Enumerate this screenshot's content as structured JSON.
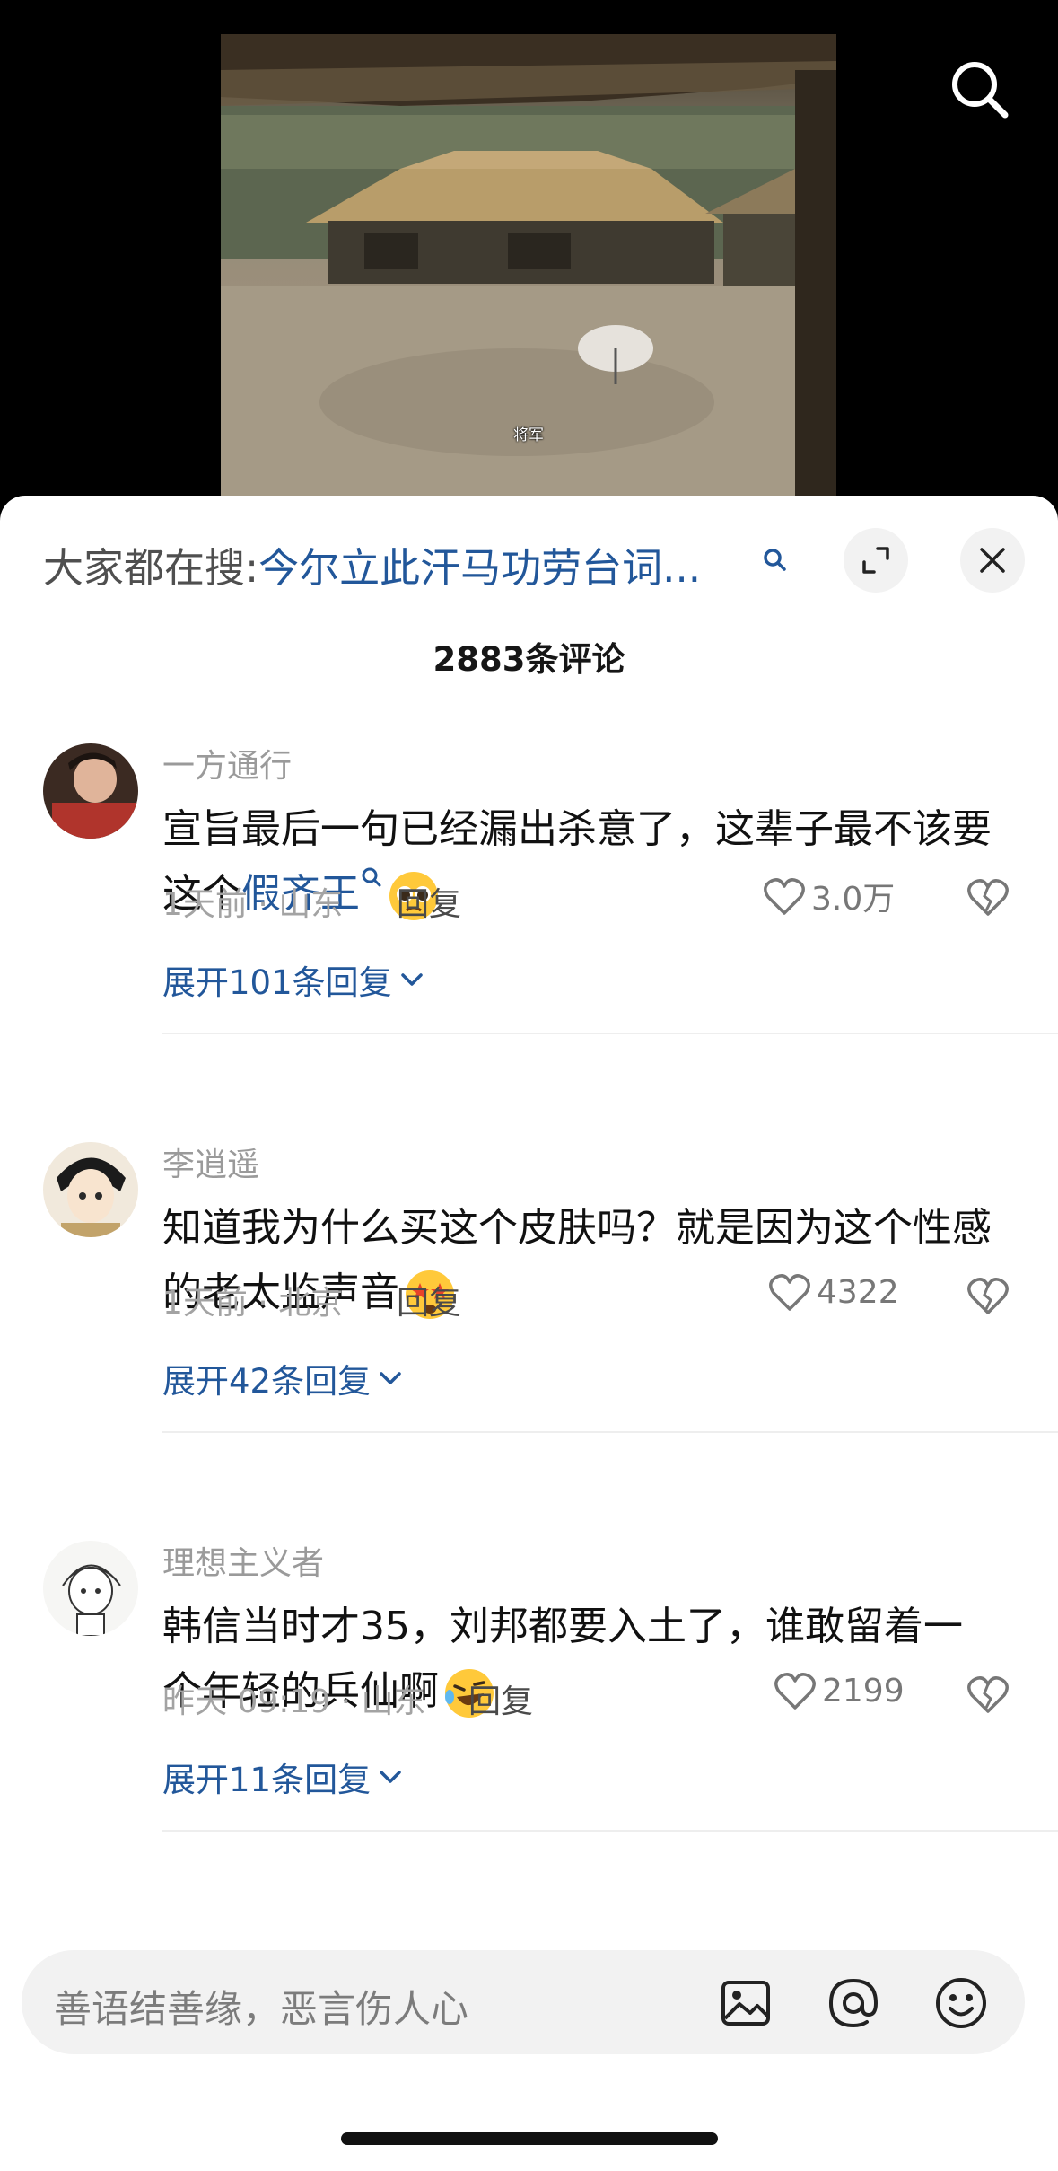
{
  "video": {
    "caption": "将军"
  },
  "search": {
    "prefix": "大家都在搜:",
    "query": "今尔立此汗马功劳台词..."
  },
  "comments_header": {
    "count_label": "2883条评论"
  },
  "comments": [
    {
      "author": "一方通行",
      "text": "宣旨最后一句已经漏出杀意了，这辈子最不该要这个",
      "keyword": "假齐王",
      "emoji": "pleading-face",
      "time_location": "1天前 · 山东",
      "reply_label": "回复",
      "likes": "3.0万",
      "expand_label": "展开101条回复"
    },
    {
      "author": "李逍遥",
      "text": "知道我为什么买这个皮肤吗？就是因为这个性感的老太监声音",
      "emoji": "star-struck-face",
      "time_location": "1天前 · 北京",
      "reply_label": "回复",
      "likes": "4322",
      "expand_label": "展开42条回复"
    },
    {
      "author": "理想主义者",
      "text": "韩信当时才35，刘邦都要入土了，谁敢留着一个年轻的兵仙啊",
      "emoji": "rolling-laughing-face",
      "time_location": "昨天 09:19 · 山东",
      "reply_label": "回复",
      "likes": "2199",
      "expand_label": "展开11条回复"
    }
  ],
  "input": {
    "placeholder": "善语结善缘，恶言伤人心"
  },
  "colors": {
    "link_blue": "#22579a",
    "meta_gray": "#a3a3a3",
    "input_bg": "#f2f2f2"
  }
}
